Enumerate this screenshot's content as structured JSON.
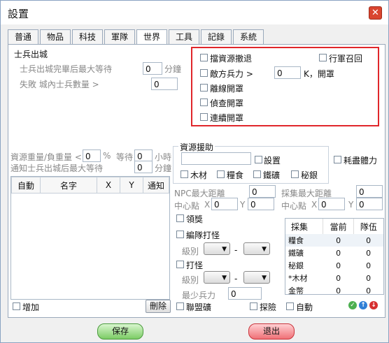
{
  "window": {
    "title": "設置"
  },
  "tabs": [
    "普通",
    "物品",
    "科技",
    "軍隊",
    "世界",
    "工具",
    "記錄",
    "系統"
  ],
  "soldier": {
    "group_title": "士兵出城",
    "max_wait_label": "士兵出城完畢后最大等待",
    "max_wait_value": "0",
    "max_wait_unit": "分鐘",
    "fail_label": "失敗 城內士兵數量 >",
    "fail_value": "0"
  },
  "options": {
    "retreat": "擋資源撤退",
    "recall": "行軍召回",
    "enemy_power": "敵方兵力 >",
    "enemy_value": "0",
    "enemy_unit": "K，開罩",
    "offline": "離線開罩",
    "scout": "偵查開罩",
    "continuous": "連續開罩"
  },
  "weight": {
    "label": "資源重量/負重量 <",
    "value": "0",
    "percent": "%",
    "wait_label": "等待",
    "wait_value": "0",
    "wait_unit": "小時",
    "notify_label": "通知士兵出城后最大等待",
    "notify_value": "0",
    "notify_unit": "分鐘"
  },
  "list": {
    "columns": [
      "自動",
      "名字",
      "X",
      "Y",
      "通知"
    ]
  },
  "aid": {
    "group_title": "資源援助",
    "settings": "設置",
    "exhaust": "耗盡體力",
    "wood": "木材",
    "food": "糧食",
    "iron": "鐵礦",
    "silver": "秘銀"
  },
  "npc": {
    "max_dist_label": "NPC最大距離",
    "max_dist_value": "0",
    "center_label": "中心點",
    "x_label": "X",
    "x_value": "0",
    "y_label": "Y",
    "y_value": "0",
    "reward": "領獎",
    "team_fight": "編隊打怪",
    "level1": "級別",
    "dash1": "-",
    "fight": "打怪",
    "level2": "級別",
    "dash2": "-",
    "min_power_label": "最少兵力",
    "min_power_value": "0"
  },
  "gather": {
    "max_dist_label": "採集最大距離",
    "max_dist_value": "0",
    "center_label": "中心點",
    "x_label": "X",
    "x_value": "0",
    "y_label": "Y",
    "y_value": "0",
    "table_headers": [
      "採集",
      "當前",
      "隊伍"
    ],
    "rows": [
      [
        "糧食",
        "0",
        "0"
      ],
      [
        "鐵礦",
        "0",
        "0"
      ],
      [
        "秘銀",
        "0",
        "0"
      ],
      [
        "*木材",
        "0",
        "0"
      ],
      [
        "金幣",
        "0",
        "0"
      ]
    ]
  },
  "bottom": {
    "add": "增加",
    "delete": "刪除",
    "alliance": "聯盟礦",
    "explore": "探險",
    "auto": "自動"
  },
  "buttons": {
    "save": "保存",
    "exit": "退出"
  },
  "colors": {
    "highlight": "#e0262b",
    "save": "#7ccc65",
    "exit": "#f07177"
  }
}
